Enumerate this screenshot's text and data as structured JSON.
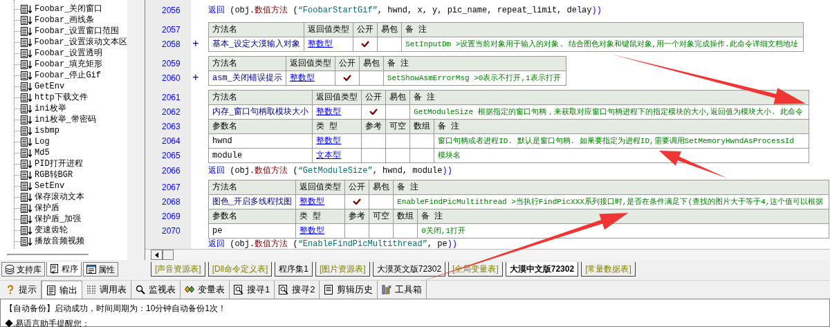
{
  "tree": {
    "items": [
      {
        "label": "Foobar_关闭窗口"
      },
      {
        "label": "Foobar_画线条"
      },
      {
        "label": "Foobar_设置窗口范围"
      },
      {
        "label": "Foobar_设置滚动文本区"
      },
      {
        "label": "Foobar_设置透明"
      },
      {
        "label": "Foobar_填充矩形"
      },
      {
        "label": "Foobar_停止Gif"
      },
      {
        "label": "GetEnv"
      },
      {
        "label": "http下载文件"
      },
      {
        "label": "ini枚举"
      },
      {
        "label": "ini枚举_带密码"
      },
      {
        "label": "isbmp"
      },
      {
        "label": "Log"
      },
      {
        "label": "Md5"
      },
      {
        "label": "PID打开进程"
      },
      {
        "label": "RGB转BGR"
      },
      {
        "label": "SetEnv"
      },
      {
        "label": "保存滚动文本"
      },
      {
        "label": "保护盾"
      },
      {
        "label": "保护盾_加强"
      },
      {
        "label": "变速齿轮"
      },
      {
        "label": "播放音频视频"
      }
    ]
  },
  "code": {
    "blocks": [
      {
        "kind": "code",
        "line": "2056",
        "tokens": [
          {
            "kind": "keyword",
            "text": "返回"
          },
          {
            "kind": "plain",
            "text": " (obj."
          },
          {
            "kind": "method",
            "text": "数值方法"
          },
          {
            "kind": "plain",
            "text": " ("
          },
          {
            "kind": "string",
            "text": "“FoobarStartGif”"
          },
          {
            "kind": "plain",
            "text": ", hwnd, x, y, pic_name, repeat_limit, delay"
          },
          {
            "kind": "keyword",
            "text": "))"
          }
        ]
      },
      {
        "kind": "table",
        "rows": [
          {
            "kind": "header",
            "line": "2057",
            "cells": [
              "方法名",
              "返回值类型",
              "公开",
              "易包",
              "备 注"
            ]
          },
          {
            "kind": "method",
            "line": "2058",
            "expander": "+",
            "name": "基本_设定大漠输入对象",
            "type": "整数型",
            "public": true,
            "note": "SetInputDm  >设置当前对象用于输入的对象. 结合图色对象和键鼠对象,用一个对象完成操作.此命令详细文档地址"
          }
        ]
      },
      {
        "kind": "table",
        "rows": [
          {
            "kind": "header",
            "line": "2059",
            "cells": [
              "方法名",
              "返回值类型",
              "公开",
              "易包",
              "备 注"
            ]
          },
          {
            "kind": "method",
            "line": "2060",
            "expander": "+",
            "name": "asm_关闭错误提示",
            "type": "整数型",
            "public": true,
            "note": "SetShowAsmErrorMsg >0表示不打开,1表示打开"
          }
        ]
      },
      {
        "kind": "table",
        "rows": [
          {
            "kind": "header",
            "line": "2061",
            "cells": [
              "方法名",
              "返回值类型",
              "公开",
              "易包",
              "备 注"
            ]
          },
          {
            "kind": "method",
            "line": "2062",
            "name": "内存_窗口句柄取模块大小",
            "type": "整数型",
            "public": true,
            "note": "GetModuleSize 根据指定的窗口句柄，来获取对应窗口句柄进程下的指定模块的大小,返回值为模块大小. 此命令"
          },
          {
            "kind": "header",
            "line": "2063",
            "cells": [
              "参数名",
              "类 型",
              "参考",
              "可空",
              "数组",
              "备 注"
            ]
          },
          {
            "kind": "param",
            "line": "2064",
            "name": "hwnd",
            "type": "整数型",
            "note": "窗口句柄或者进程ID.  默认是窗口句柄. 如果要指定为进程ID,需要调用SetMemoryHwndAsProcessId"
          },
          {
            "kind": "param",
            "line": "2065",
            "name": "module",
            "type": "文本型",
            "note": "模块名"
          }
        ]
      },
      {
        "kind": "code",
        "line": "2066",
        "tokens": [
          {
            "kind": "keyword",
            "text": "返回"
          },
          {
            "kind": "plain",
            "text": " (obj."
          },
          {
            "kind": "method",
            "text": "数值方法"
          },
          {
            "kind": "plain",
            "text": " ("
          },
          {
            "kind": "string",
            "text": "“GetModuleSize”"
          },
          {
            "kind": "plain",
            "text": ", hwnd, module"
          },
          {
            "kind": "keyword",
            "text": "))"
          }
        ]
      },
      {
        "kind": "table",
        "rows": [
          {
            "kind": "header",
            "line": "2067",
            "cells": [
              "方法名",
              "返回值类型",
              "公开",
              "易包",
              "备 注"
            ]
          },
          {
            "kind": "method",
            "line": "2068",
            "name": "图色_开启多线程找图",
            "type": "整数型",
            "public": true,
            "note": "EnableFindPicMultithread >当执行FindPicXXX系列接口时,是否在条件满足下(查找的图片大于等于4,这个值可以根据"
          },
          {
            "kind": "header",
            "line": "2069",
            "cells": [
              "参数名",
              "类 型",
              "参考",
              "可空",
              "数组",
              "备 注"
            ]
          },
          {
            "kind": "param",
            "line": "2070",
            "name": "pe",
            "type": "整数型",
            "note": "0关闭,1打开"
          }
        ]
      },
      {
        "kind": "code",
        "tokens": [
          {
            "kind": "keyword",
            "text": "返回"
          },
          {
            "kind": "plain",
            "text": " (obj."
          },
          {
            "kind": "method",
            "text": "数值方法"
          },
          {
            "kind": "plain",
            "text": " ("
          },
          {
            "kind": "string",
            "text": "“EnableFindPicMultithread”"
          },
          {
            "kind": "plain",
            "text": ", pe"
          },
          {
            "kind": "keyword",
            "text": "))"
          }
        ]
      }
    ]
  },
  "panel_tabs": [
    {
      "label": "支持库",
      "selected": false
    },
    {
      "label": "程序",
      "selected": true
    },
    {
      "label": "属性",
      "selected": false
    }
  ],
  "doc_tabs": [
    {
      "label": "[声音资源表]",
      "kind": "resource",
      "selected": false
    },
    {
      "label": "[Dll命令定义表]",
      "kind": "resource",
      "selected": false
    },
    {
      "label": "程序集1",
      "kind": "code",
      "selected": false
    },
    {
      "label": "[图片资源表]",
      "kind": "resource",
      "selected": false
    },
    {
      "label": "大漠英文版72302",
      "kind": "code",
      "selected": false
    },
    {
      "label": "[全局变量表]",
      "kind": "resource",
      "selected": false
    },
    {
      "label": "大漠中文版72302",
      "kind": "code",
      "selected": true
    },
    {
      "label": "[常量数据表]",
      "kind": "resource",
      "selected": false
    }
  ],
  "output_tabs": [
    {
      "label": "提示",
      "selected": false
    },
    {
      "label": "输出",
      "selected": true
    },
    {
      "label": "调用表",
      "selected": false
    },
    {
      "label": "监视表",
      "selected": false
    },
    {
      "label": "变量表",
      "selected": false
    },
    {
      "label": "搜寻1",
      "selected": false
    },
    {
      "label": "搜寻2",
      "selected": false
    },
    {
      "label": "剪辑历史",
      "selected": false
    },
    {
      "label": "工具箱",
      "selected": false
    }
  ],
  "output": {
    "lines": [
      "【自动备份】启动成功，时间周期为：10分钟自动备份1次！",
      "◆.易语言助手提醒您："
    ]
  }
}
